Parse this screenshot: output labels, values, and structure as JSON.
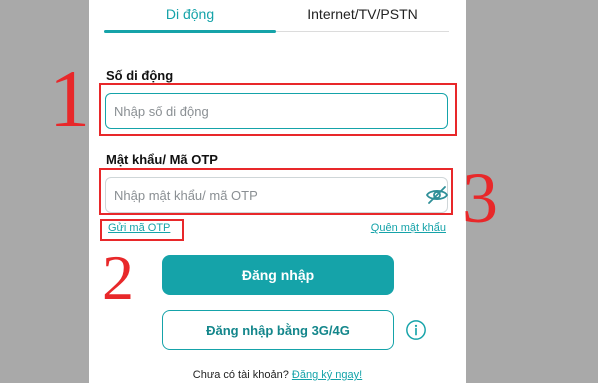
{
  "tabs": [
    {
      "label": "Di động",
      "active": true
    },
    {
      "label": "Internet/TV/PSTN",
      "active": false
    }
  ],
  "phone": {
    "label": "Số di động",
    "placeholder": "Nhập số di động",
    "value": ""
  },
  "password": {
    "label": "Mật khẩu/ Mã OTP",
    "placeholder": "Nhập mật khẩu/ mã OTP",
    "value": "",
    "toggle_icon": "eye-slash-icon"
  },
  "links": {
    "send_otp": "Gửi mã OTP",
    "forgot_password": "Quên mật khẩu"
  },
  "buttons": {
    "login": "Đăng nhập",
    "login_3g": "Đăng nhập bằng 3G/4G",
    "info_icon": "info-circle-icon"
  },
  "signup": {
    "prompt": "Chưa có tài khoản?",
    "link": "Đăng ký ngay!"
  },
  "annotations": [
    "1",
    "2",
    "3"
  ],
  "colors": {
    "accent": "#15a3a9",
    "annotation": "#e8282a",
    "backdrop": "#a9a9a9"
  }
}
